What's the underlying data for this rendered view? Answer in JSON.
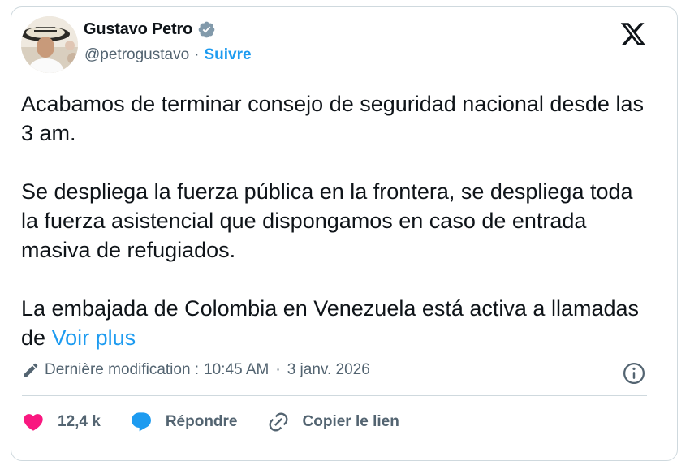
{
  "author": {
    "name": "Gustavo Petro",
    "handle": "@petrogustavo",
    "separator": "·",
    "follow_label": "Suivre",
    "verified": true,
    "avatar_icon": "user-avatar"
  },
  "platform_logo": "x-logo-icon",
  "tweet": {
    "paragraphs": [
      "Acabamos de terminar consejo de seguridad nacional desde las 3 am.",
      "Se despliega la fuerza pública en la frontera, se despliega toda la fuerza asistencial que dispongamos en caso de entrada masiva de refugiados.",
      "La embajada de Colombia en Venezuela está activa a llamadas de"
    ],
    "see_more": "Voir plus"
  },
  "meta": {
    "edited_label": "Dernière modification :",
    "time": "10:45 AM",
    "separator": "·",
    "date": "3 janv. 2026"
  },
  "actions": {
    "likes_count": "12,4 k",
    "reply_label": "Répondre",
    "copy_link_label": "Copier le lien"
  },
  "colors": {
    "accent": "#1d9bf0",
    "like": "#f91880",
    "muted": "#536471",
    "text": "#0f1419",
    "border": "#cfd9de"
  }
}
